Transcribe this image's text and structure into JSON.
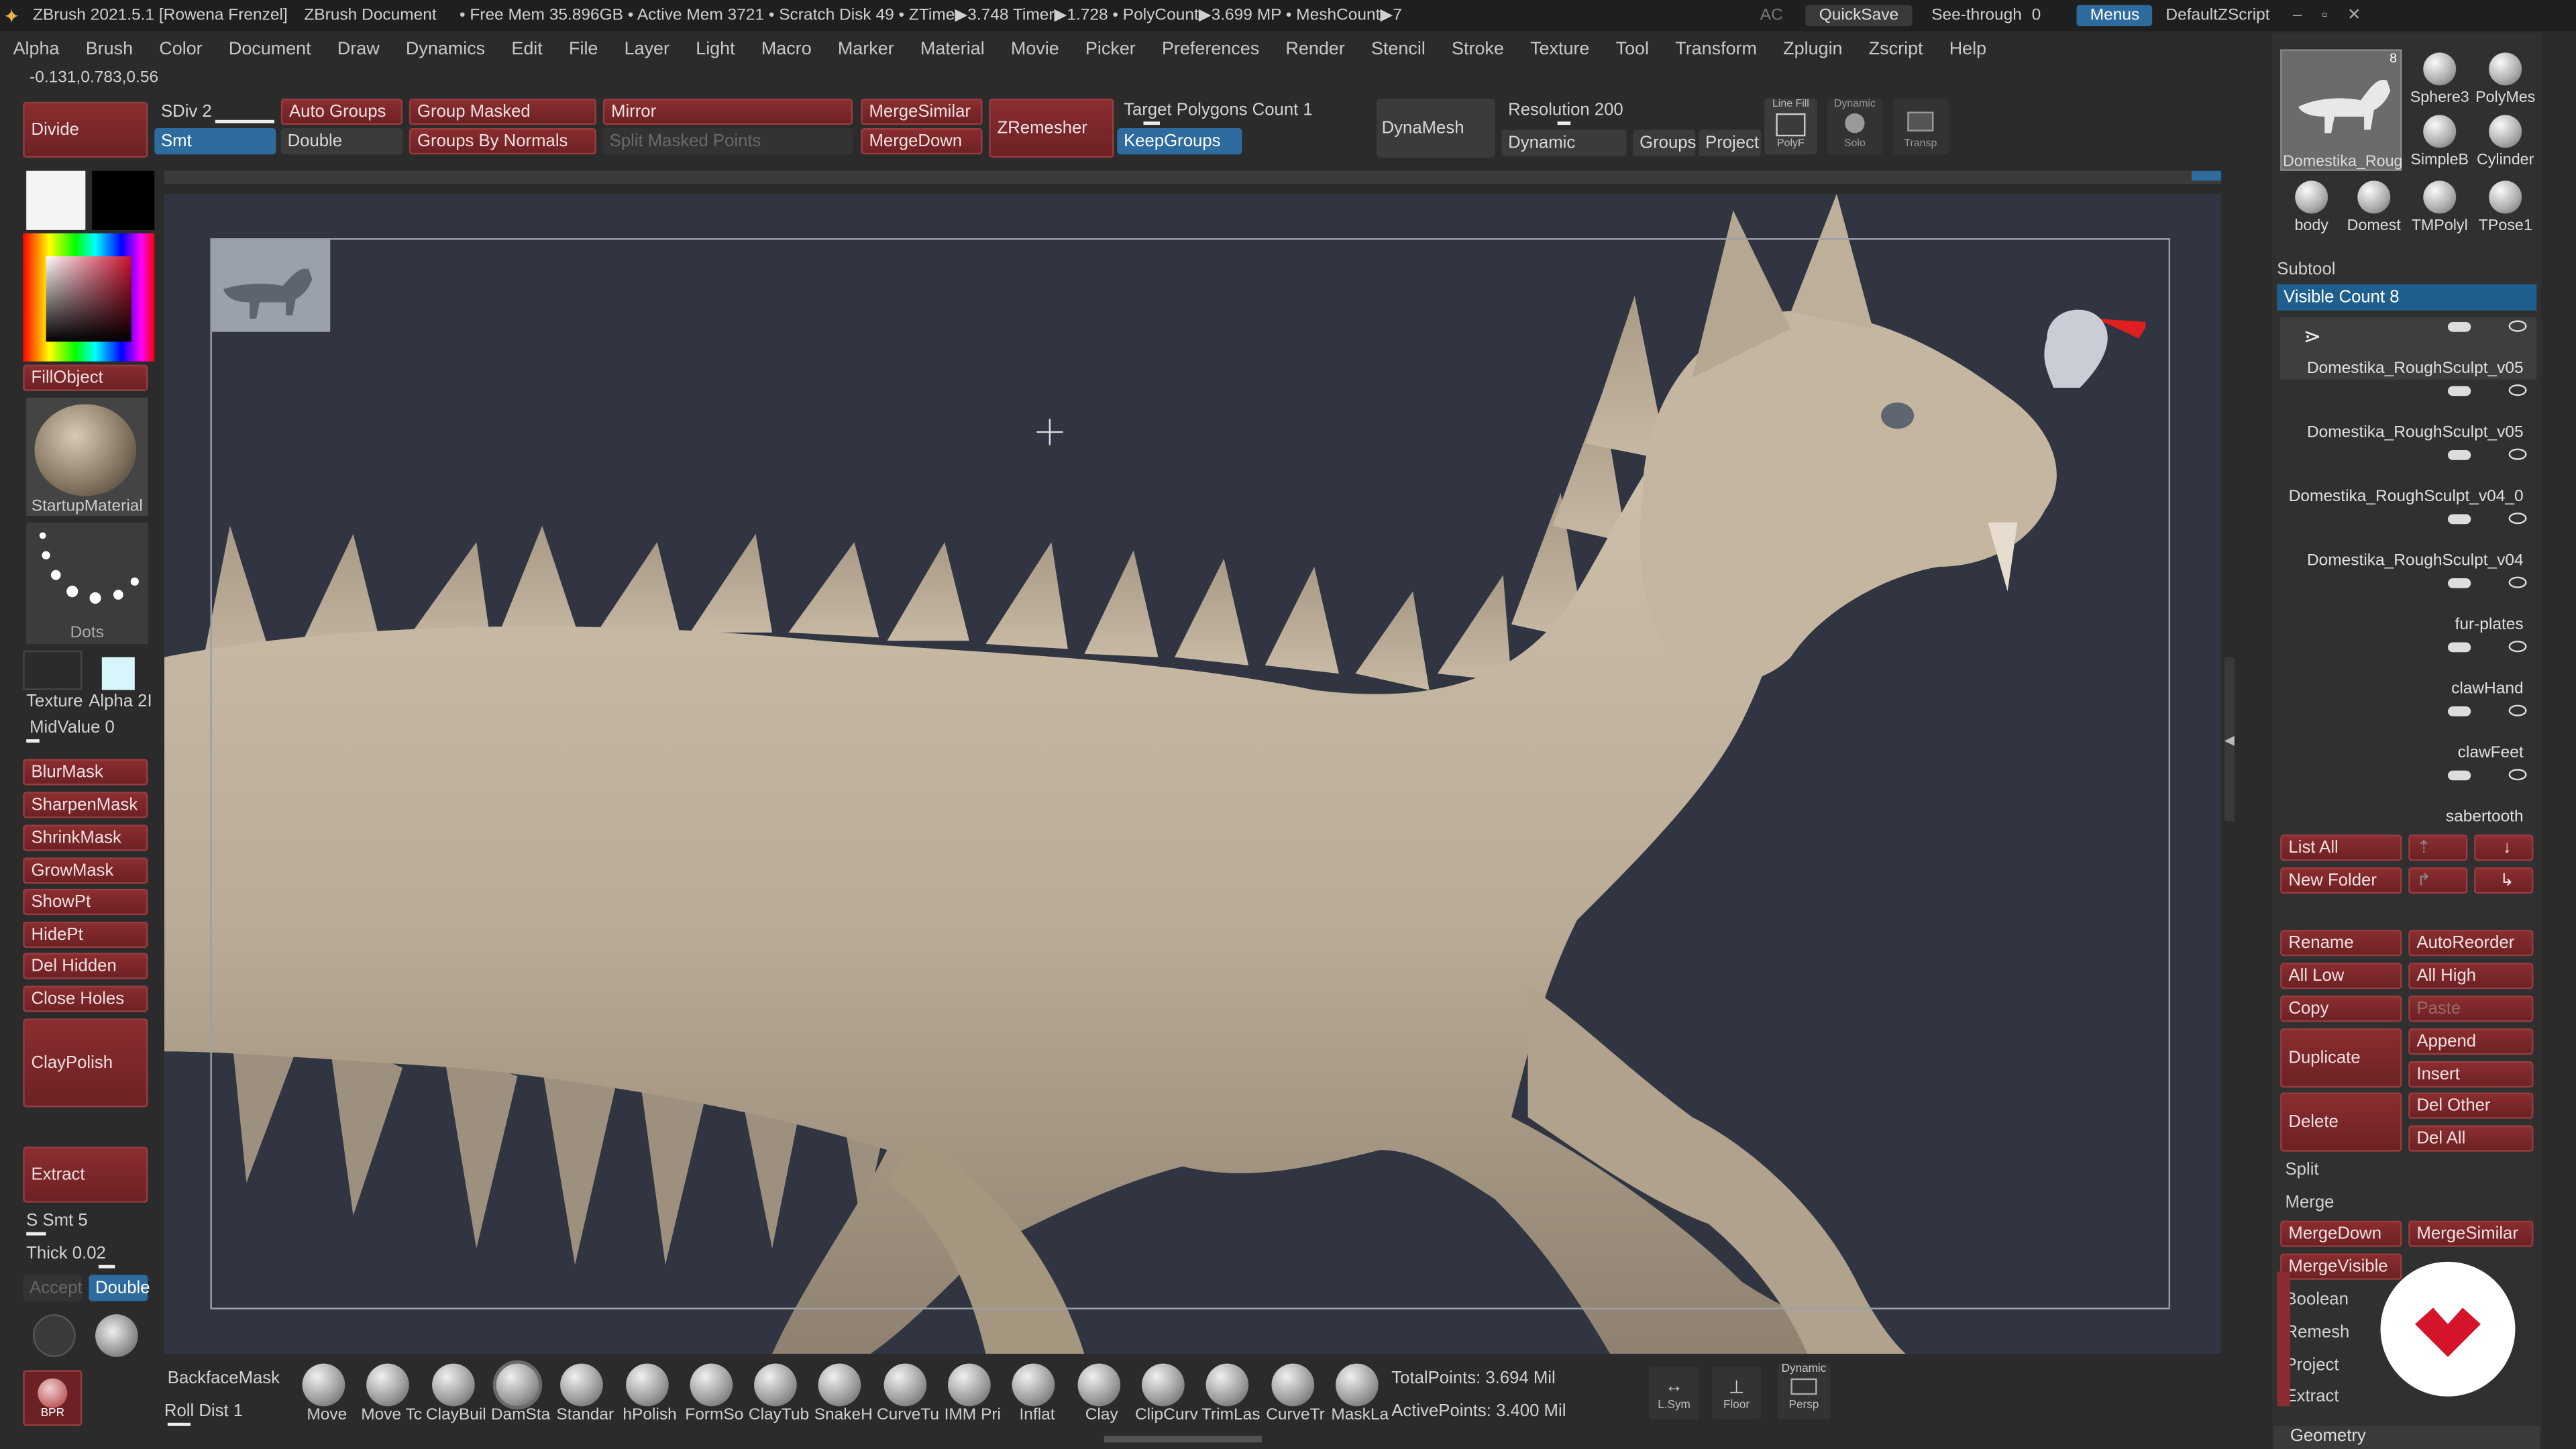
{
  "titlebar": {
    "app": "ZBrush 2021.5.1 [Rowena Frenzel]",
    "doc": "ZBrush Document",
    "stats": "• Free Mem 35.896GB • Active Mem 3721 • Scratch Disk 49 • ZTime▶3.748 Timer▶1.728 • PolyCount▶3.699 MP • MeshCount▶7",
    "ac": "AC",
    "quicksave": "QuickSave",
    "seethrough": "See-through",
    "seethrough_value": "0",
    "menus": "Menus",
    "script": "DefaultZScript"
  },
  "menubar": [
    "Alpha",
    "Brush",
    "Color",
    "Document",
    "Draw",
    "Dynamics",
    "Edit",
    "File",
    "Layer",
    "Light",
    "Macro",
    "Marker",
    "Material",
    "Movie",
    "Picker",
    "Preferences",
    "Render",
    "Stencil",
    "Stroke",
    "Texture",
    "Tool",
    "Transform",
    "Zplugin",
    "Zscript",
    "Help"
  ],
  "coords": "-0.131,0.783,0.56",
  "topshelf": {
    "divide": "Divide",
    "sdiv": "SDiv 2",
    "smt": "Smt",
    "autogroups": "Auto Groups",
    "double": "Double",
    "groupmasked": "Group Masked",
    "groupsbynormals": "Groups By Normals",
    "mirror": "Mirror",
    "splitmasked": "Split Masked Points",
    "mergesimilar": "MergeSimilar",
    "mergedown": "MergeDown",
    "zremesher": "ZRemesher",
    "target": "Target Polygons Count 1",
    "keepgroups": "KeepGroups",
    "dynamesh": "DynaMesh",
    "resolution": "Resolution 200",
    "dynamic": "Dynamic",
    "groups": "Groups",
    "project": "Project",
    "linefill": "Line Fill",
    "polyf": "PolyF",
    "solo_top": "Dynamic",
    "solo": "Solo",
    "transp": "Transp"
  },
  "leftshelf": {
    "fillobject": "FillObject",
    "material": "StartupMaterial",
    "stroke": "Dots",
    "texture": "Texture",
    "alpha": "Alpha 2I",
    "midvalue": "MidValue 0",
    "buttons": [
      "BlurMask",
      "SharpenMask",
      "ShrinkMask",
      "GrowMask",
      "ShowPt",
      "HidePt",
      "Del Hidden",
      "Close Holes"
    ],
    "claypolish": "ClayPolish",
    "extract": "Extract",
    "ssmt": "S Smt 5",
    "thick": "Thick 0.02",
    "accept": "Accept",
    "double": "Double",
    "bpr": "BPR"
  },
  "subtool": {
    "header": "Subtool",
    "visible": "Visible Count 8",
    "items": [
      "Domestika_RoughSculpt_v05",
      "Domestika_RoughSculpt_v05",
      "Domestika_RoughSculpt_v04_0",
      "Domestika_RoughSculpt_v04",
      "fur-plates",
      "clawHand",
      "clawFeet",
      "sabertooth"
    ],
    "listall": "List All",
    "newfolder": "New Folder",
    "rename": "Rename",
    "autoreorder": "AutoReorder",
    "alllow": "All Low",
    "allhigh": "All High",
    "copy": "Copy",
    "paste": "Paste",
    "duplicate": "Duplicate",
    "append": "Append",
    "insert": "Insert",
    "delete": "Delete",
    "delother": "Del Other",
    "delall": "Del All",
    "split": "Split",
    "merge": "Merge",
    "mergedown": "MergeDown",
    "mergesimilar": "MergeSimilar",
    "mergevisible": "MergeVisible",
    "boolean": "Boolean",
    "remesh": "Remesh",
    "project": "Project",
    "extract": "Extract",
    "geometry": "Geometry"
  },
  "toolpalette": {
    "current": "Domestika_Roug",
    "count": "8",
    "items": [
      "Sphere3",
      "PolyMes",
      "SimpleB",
      "Cylinder",
      "body",
      "Domest",
      "TMPolyl",
      "TPose1"
    ]
  },
  "bottom": {
    "backfacemask": "BackfaceMask",
    "rolldist": "Roll Dist 1",
    "brushes": [
      "Move",
      "Move Tc",
      "ClayBuil",
      "DamSta",
      "Standar",
      "hPolish",
      "FormSo",
      "ClayTub",
      "SnakeH",
      "CurveTu",
      "IMM Pri",
      "Inflat",
      "Clay",
      "ClipCurv",
      "TrimLas",
      "CurveTr",
      "MaskLa"
    ],
    "totalpoints": "TotalPoints: 3.694 Mil",
    "activepoints": "ActivePoints: 3.400 Mil",
    "lsym": "L.Sym",
    "floor": "Floor",
    "persp": "Persp",
    "persp_top": "Dynamic"
  }
}
